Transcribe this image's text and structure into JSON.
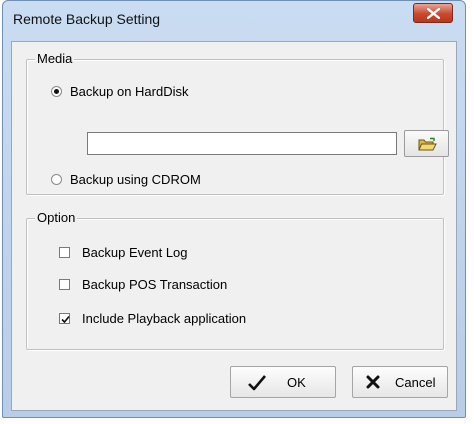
{
  "window": {
    "title": "Remote Backup Setting"
  },
  "media": {
    "label": "Media",
    "option_harddisk": "Backup on HardDisk",
    "option_cdrom": "Backup using CDROM",
    "selected": "harddisk",
    "path_value": "",
    "icons": {
      "browse": "folder-open-icon"
    }
  },
  "option": {
    "label": "Option",
    "items": [
      {
        "label": "Backup Event Log",
        "checked": false
      },
      {
        "label": "Backup POS Transaction",
        "checked": false
      },
      {
        "label": "Include Playback application",
        "checked": true
      }
    ]
  },
  "buttons": {
    "ok": "OK",
    "cancel": "Cancel"
  },
  "colors": {
    "title_bar": "#c9dcf2",
    "close_button": "#c9492f",
    "dialog_bg": "#f0f0f0"
  }
}
